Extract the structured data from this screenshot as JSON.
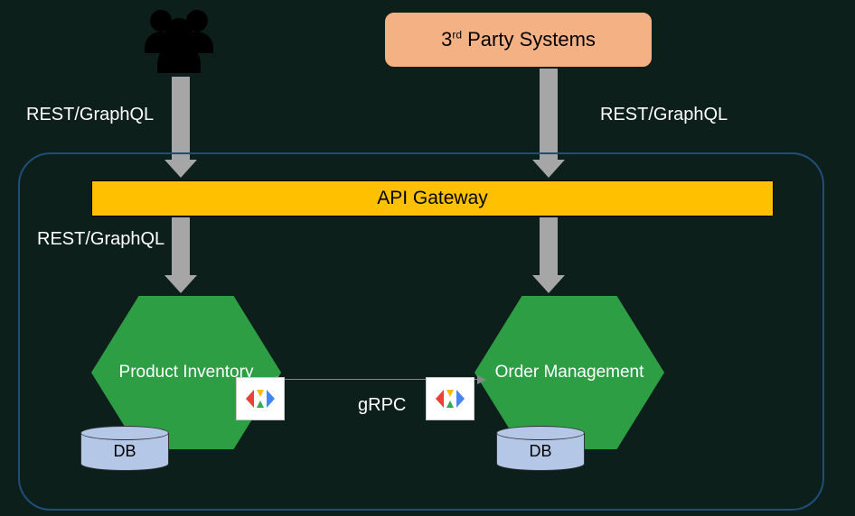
{
  "clients": {
    "users_icon_name": "users",
    "third_party_label": "3rd Party Systems"
  },
  "labels": {
    "rest_graphql_left_top": "REST/GraphQL",
    "rest_graphql_right_top": "REST/GraphQL",
    "rest_graphql_left_bottom": "REST/GraphQL",
    "grpc": "gRPC"
  },
  "gateway": {
    "title": "API Gateway"
  },
  "services": {
    "product": {
      "name": "Product Inventory",
      "db_label": "DB"
    },
    "order": {
      "name": "Order Management",
      "db_label": "DB"
    }
  },
  "colors": {
    "background": "#0d1f1a",
    "third_party_fill": "#f4b183",
    "gateway_fill": "#ffc000",
    "service_fill": "#2e9e45",
    "db_fill": "#b4c7e7",
    "arrow_fill": "#a6a6a6",
    "boundary_stroke": "#1f4e79"
  },
  "arrows": [
    {
      "from": "users",
      "to": "api-gateway",
      "protocol": "REST/GraphQL"
    },
    {
      "from": "third-party-systems",
      "to": "api-gateway",
      "protocol": "REST/GraphQL"
    },
    {
      "from": "api-gateway",
      "to": "product-inventory",
      "protocol": "REST/GraphQL"
    },
    {
      "from": "api-gateway",
      "to": "order-management",
      "protocol": ""
    },
    {
      "from": "product-inventory",
      "to": "order-management",
      "protocol": "gRPC",
      "bidirectional": true
    }
  ]
}
